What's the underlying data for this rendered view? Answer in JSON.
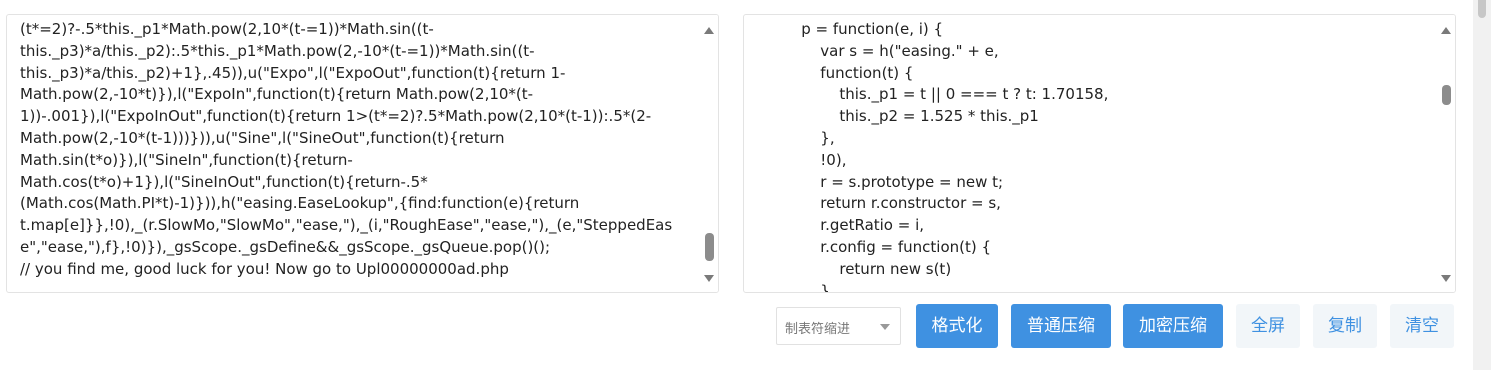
{
  "input_panel": {
    "lines": [
      "(t*=2)?-.5*this._p1*Math.pow(2,10*(t-=1))*Math.sin((t-",
      "this._p3)*a/this._p2):.5*this._p1*Math.pow(2,-10*(t-=1))*Math.sin((t-",
      "this._p3)*a/this._p2)+1},.45)),u(\"Expo\",l(\"ExpoOut\",function(t){return 1-",
      "Math.pow(2,-10*t)}),l(\"ExpoIn\",function(t){return Math.pow(2,10*(t-",
      "1))-.001}),l(\"ExpoInOut\",function(t){return 1>(t*=2)?.5*Math.pow(2,10*(t-1)):.5*(2-",
      "Math.pow(2,-10*(t-1)))})),u(\"Sine\",l(\"SineOut\",function(t){return",
      "Math.sin(t*o)}),l(\"SineIn\",function(t){return-",
      "Math.cos(t*o)+1}),l(\"SineInOut\",function(t){return-.5*",
      "(Math.cos(Math.PI*t)-1)})),h(\"easing.EaseLookup\",{find:function(e){return",
      "t.map[e]}},!0),_(r.SlowMo,\"SlowMo\",\"ease,\"),_(i,\"RoughEase\",\"ease,\"),_(e,\"SteppedEas",
      "e\",\"ease,\"),f},!0)}),_gsScope._gsDefine&&_gsScope._gsQueue.pop()();",
      "// you find me, good luck for you! Now go to Upl00000000ad.php"
    ]
  },
  "output_panel": {
    "lines": [
      "            p = function(e, i) {",
      "                var s = h(\"easing.\" + e,",
      "                function(t) {",
      "                    this._p1 = t || 0 === t ? t: 1.70158,",
      "                    this._p2 = 1.525 * this._p1",
      "                },",
      "                !0),",
      "                r = s.prototype = new t;",
      "                return r.constructor = s,",
      "                r.getRatio = i,",
      "                r.config = function(t) {",
      "                    return new s(t)",
      "                }"
    ]
  },
  "toolbar": {
    "indent_select": "制表符缩进",
    "format_label": "格式化",
    "compress_label": "普通压缩",
    "encrypt_label": "加密压缩",
    "fullscreen_label": "全屏",
    "copy_label": "复制",
    "clear_label": "清空"
  },
  "colors": {
    "primary": "#3f91e1",
    "ghost_bg": "#f2f6f9"
  }
}
